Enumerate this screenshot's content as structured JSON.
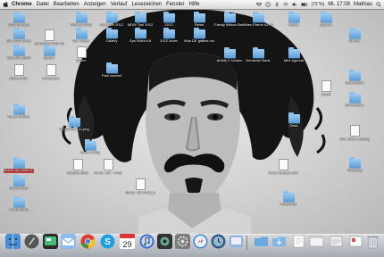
{
  "menubar": {
    "app_name": "Chrome",
    "items": [
      "Datei",
      "Bearbeiten",
      "Anzeigen",
      "Verlauf",
      "Lesezeichen",
      "Fenster",
      "Hilfe"
    ],
    "battery": "(72 %)",
    "clock": "Mi. 17:08",
    "user": "Mathias"
  },
  "desktop_icons": [
    {
      "label": "MINI-E video"
    },
    {
      "label": "Mai 2012 video"
    },
    {
      "label": "LB Wilhelm Nov 2011 pdf"
    },
    {
      "label": "Wilhelm 2011"
    },
    {
      "label": "Der Trailer"
    },
    {
      "label": "Kalender 2012"
    },
    {
      "label": "MDW Tool 2012"
    },
    {
      "label": "Sys Video-Kit"
    },
    {
      "label": "Gallery"
    },
    {
      "label": "2012"
    },
    {
      "label": "Reise"
    },
    {
      "label": "Family Wilson Bank"
    },
    {
      "label": "Video Ebene ILE Wilm"
    },
    {
      "label": "mobile"
    },
    {
      "label": "Exports"
    },
    {
      "label": "Cafe Alto 2012"
    },
    {
      "label": "Spoiler"
    },
    {
      "label": "Unterl."
    },
    {
      "label": "Banner Ra-"
    },
    {
      "label": "xmaswave"
    },
    {
      "label": "Paul mechel"
    },
    {
      "label": "MUNK work in progress"
    },
    {
      "label": "Neuer Ordner"
    },
    {
      "label": "2012 cover"
    },
    {
      "label": "Wos DK galbes cover"
    },
    {
      "label": "Amels 2 Johann"
    },
    {
      "label": "Deutsche Bank"
    },
    {
      "label": "Mini Agenda"
    },
    {
      "label": "Munk - DK - Final"
    },
    {
      "label": "Moos sitting"
    },
    {
      "label": "MUNK Alu Alles 2012"
    },
    {
      "label": "Chartes 2012"
    },
    {
      "label": "Munk - DK Final_3"
    },
    {
      "label": "Desk"
    },
    {
      "label": "Ya De Gomma 2012"
    },
    {
      "label": "FOLDER3"
    },
    {
      "label": "FK-Gomma"
    },
    {
      "label": "Guido 2012"
    },
    {
      "label": "Werbung"
    },
    {
      "label": "Ord. 2012 Leistungen"
    },
    {
      "label": "Ordner"
    },
    {
      "label": "Screenshot"
    },
    {
      "label": "Dokumente"
    },
    {
      "label": "Musik"
    }
  ],
  "dock": {
    "apps": [
      "finder-icon",
      "rocket-icon",
      "dashboard-icon",
      "mail-icon",
      "chrome-icon",
      "skype-icon",
      "ical-icon",
      "itunes-icon",
      "photo-icon",
      "settings-icon",
      "safari-icon",
      "time-machine-icon",
      "app-icon",
      "app-icon-2"
    ],
    "calendar_day": "29",
    "right_items": [
      "folder-icon",
      "downloads-icon",
      "documents-icon",
      "window-icon",
      "trash-icon"
    ]
  },
  "colors": {
    "folder": "#6aa9de",
    "menubar": "#e4e4e4",
    "selected_label": "#c43b3b"
  }
}
